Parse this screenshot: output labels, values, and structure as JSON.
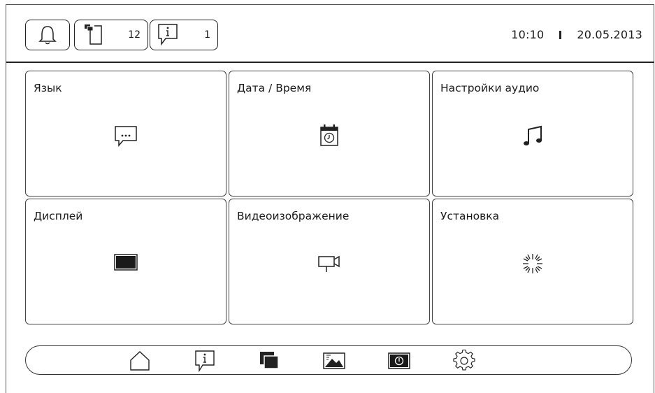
{
  "header": {
    "messages_count": "12",
    "info_count": "1",
    "time": "10:10",
    "date": "20.05.2013"
  },
  "tiles": [
    {
      "label": "Язык",
      "icon": "speech-bubble-dots-icon"
    },
    {
      "label": "Дата / Время",
      "icon": "calendar-clock-icon"
    },
    {
      "label": "Настройки аудио",
      "icon": "music-note-icon"
    },
    {
      "label": "Дисплей",
      "icon": "display-icon"
    },
    {
      "label": "Видеоизображение",
      "icon": "video-camera-icon"
    },
    {
      "label": "Установка",
      "icon": "brightness-spark-icon"
    }
  ],
  "dock": [
    {
      "name": "home-icon"
    },
    {
      "name": "info-bubble-icon"
    },
    {
      "name": "stacked-messages-icon"
    },
    {
      "name": "picture-icon"
    },
    {
      "name": "power-icon"
    },
    {
      "name": "gear-icon"
    }
  ]
}
